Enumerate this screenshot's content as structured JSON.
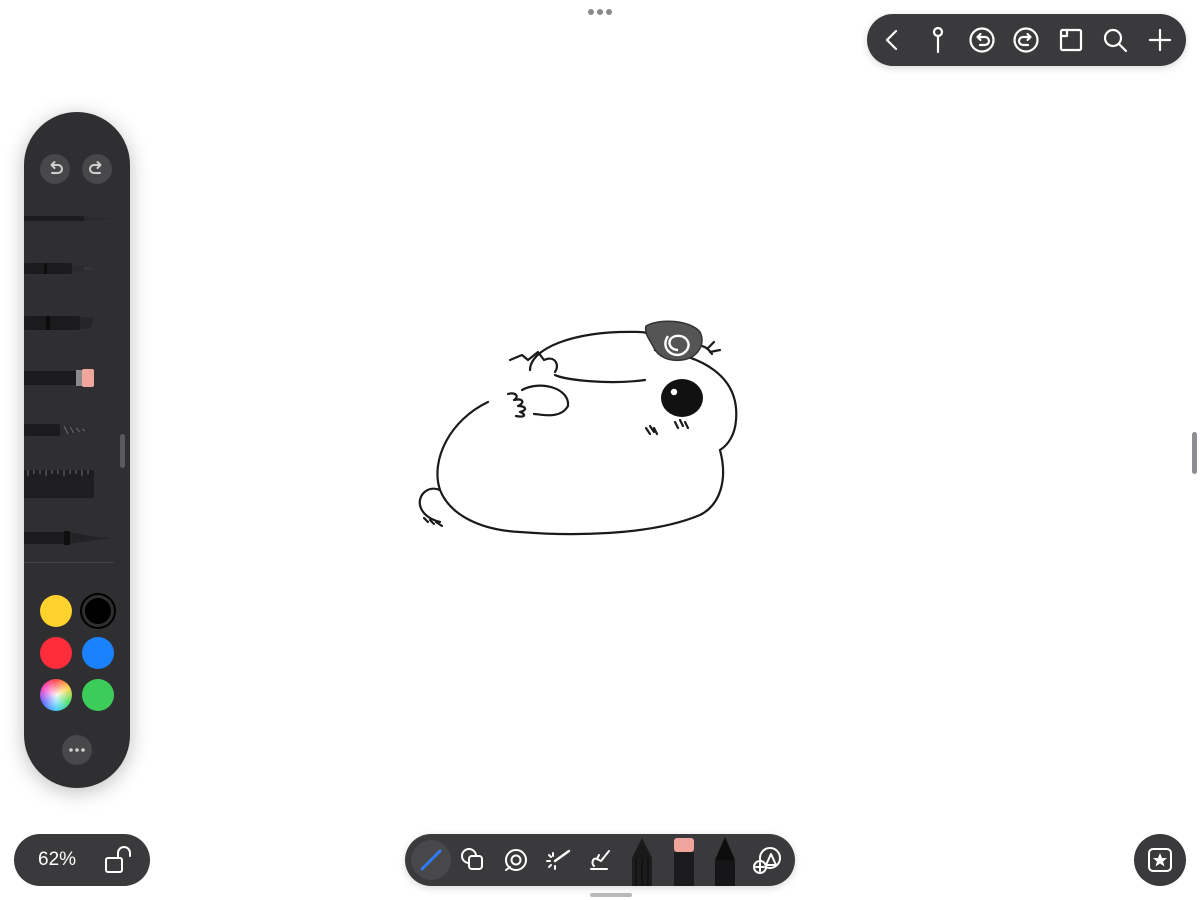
{
  "zoom": {
    "value": "62%"
  },
  "top_toolbar": {
    "icons": [
      "back-chevron-icon",
      "pin-icon",
      "undo-circle-icon",
      "redo-circle-icon",
      "canvas-frame-icon",
      "search-icon",
      "add-icon"
    ]
  },
  "palette": {
    "tools": [
      "pencil",
      "fine-liner",
      "marker",
      "eraser",
      "airbrush",
      "ruler",
      "brush-pen"
    ],
    "colors": {
      "yellow": "#ffd22e",
      "black": "#000000",
      "red": "#ff2d3a",
      "blue": "#1a82ff",
      "spectrum": "color-wheel",
      "green": "#3ccc5a"
    },
    "selected_color": "black"
  },
  "bottom_toolbar": {
    "tools": [
      "pencil-tool-icon",
      "shapes-icon",
      "fill-icon",
      "magic-wand-icon",
      "smudge-icon",
      "pencil-brush",
      "eraser-brush",
      "pen-brush",
      "add-shape-icon"
    ],
    "active_tool": "pencil-tool-icon",
    "accent": "#2f7cf6"
  },
  "colors": {
    "toolbar_bg": "#3a3a3c",
    "palette_bg": "#2f2f31",
    "canvas_bg": "#ffffff"
  }
}
